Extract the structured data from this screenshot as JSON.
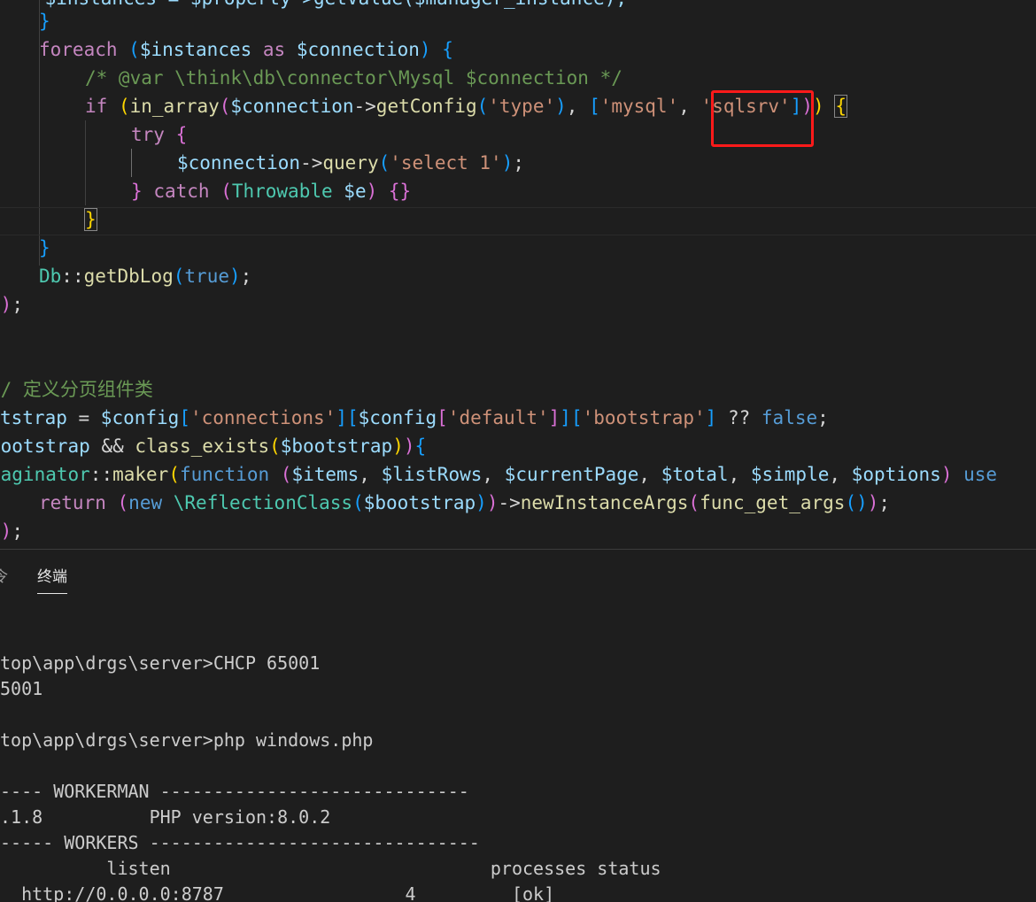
{
  "editor": {
    "line_top": "    $instances = $property->getValue($manager_instance);",
    "l1": "}",
    "l2": {
      "kw": "foreach",
      "rest_a": " (",
      "var1": "$instances",
      "as": " as ",
      "var2": "$connection",
      "rest_b": ") {"
    },
    "l3": "/* @var \\think\\db\\connector\\Mysql $connection */",
    "l4": {
      "if": "if",
      "fn": "in_array",
      "var": "$connection",
      "arrow": "->",
      "m": "getConfig",
      "s1": "'type'",
      "s2": "'mysql'",
      "s3": "'sqlsrv'"
    },
    "l5": "try",
    "l6": {
      "var": "$connection",
      "m": "query",
      "s": "'select 1'"
    },
    "l7": {
      "catch": "catch",
      "cls": "Throwable",
      "var": "$e"
    },
    "l8": "}",
    "l9": "}",
    "l10": {
      "cls": "Db",
      "m": "getDbLog",
      "v": "true"
    },
    "l11": "});",
    "l13": "// 定义分页组件类",
    "l14": {
      "var1": "tstrap",
      "var2": "$config",
      "s1": "'connections'",
      "s2": "'default'",
      "s3": "'bootstrap'",
      "f": "false"
    },
    "l15": {
      "a": "bootstrap",
      "fn": "class_exists",
      "var": "$bootstrap"
    },
    "l16": {
      "cls": "Paginator",
      "m": "maker",
      "kw": "function",
      "args": [
        "$items",
        "$listRows",
        "$currentPage",
        "$total",
        "$simple",
        "$options"
      ],
      "use": "use"
    },
    "l17": {
      "ret": "return",
      "new": "new",
      "cls": "\\ReflectionClass",
      "var": "$bootstrap",
      "m": "newInstanceArgs",
      "fn": "func_get_args"
    },
    "l18": "});"
  },
  "panel": {
    "tab_prev": "令",
    "tab_terminal": "终端"
  },
  "terminal": {
    "lines": [
      "top\\app\\drgs\\server>CHCP 65001",
      "5001",
      "",
      "top\\app\\drgs\\server>php windows.php",
      "",
      "---- WORKERMAN -----------------------------",
      ".1.8          PHP version:8.0.2",
      "----- WORKERS -------------------------------",
      "          listen                              processes status",
      "  http://0.0.0.0:8787                 4         [ok]"
    ]
  },
  "colors": {
    "highlight_box": "#ff1a1a",
    "background": "#1e1e1e"
  }
}
